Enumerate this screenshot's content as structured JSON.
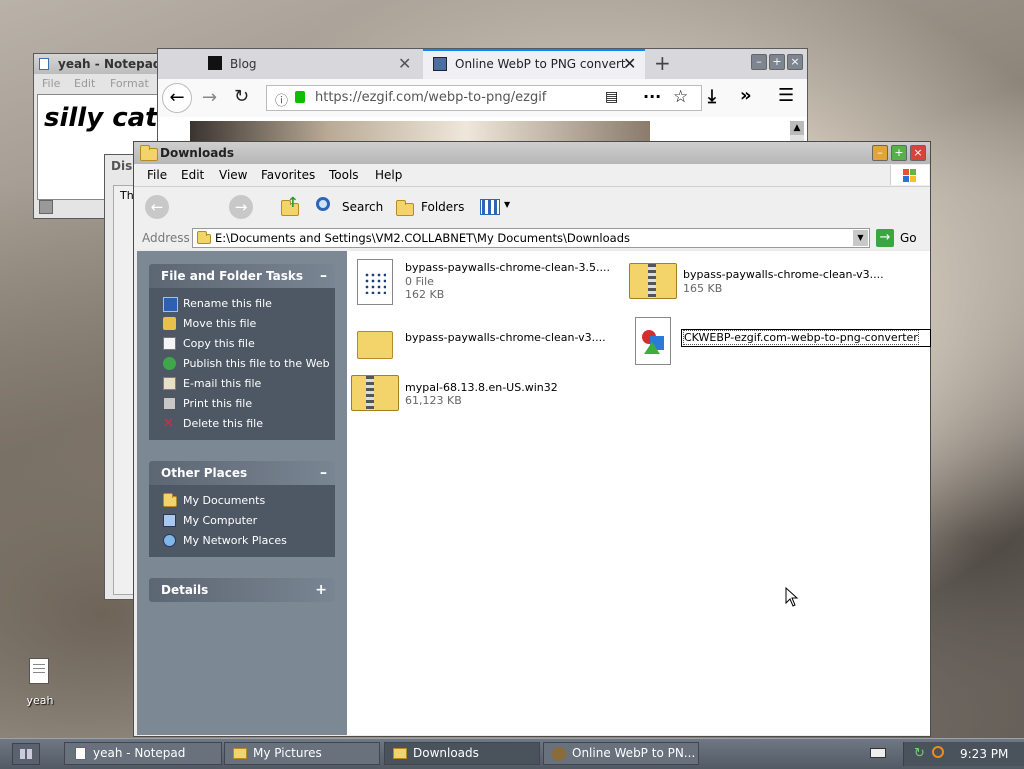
{
  "desktop": {
    "icons": [
      {
        "label": "yeah"
      }
    ]
  },
  "notepad": {
    "title": "yeah - Notepad",
    "menu": [
      "File",
      "Edit",
      "Format"
    ],
    "content": "silly cat"
  },
  "browser": {
    "tabs": [
      {
        "label": "Blog"
      },
      {
        "label": "Online WebP to PNG convert"
      }
    ],
    "url": "https://ezgif.com/webp-to-png/ezgif"
  },
  "background_window": {
    "title": "Dis",
    "tab": "Th"
  },
  "explorer": {
    "title": "Downloads",
    "menu": [
      "File",
      "Edit",
      "View",
      "Favorites",
      "Tools",
      "Help"
    ],
    "toolbar": {
      "search": "Search",
      "folders": "Folders"
    },
    "address": {
      "label": "Address",
      "path": "E:\\Documents and Settings\\VM2.COLLABNET\\My Documents\\Downloads",
      "go": "Go"
    },
    "tasks_panel": {
      "title": "File and Folder Tasks",
      "toggle": "–",
      "items": [
        "Rename this file",
        "Move this file",
        "Copy this file",
        "Publish this file to the Web",
        "E-mail this file",
        "Print this file",
        "Delete this file"
      ]
    },
    "places_panel": {
      "title": "Other Places",
      "toggle": "–",
      "items": [
        "My Documents",
        "My Computer",
        "My Network Places"
      ]
    },
    "details_panel": {
      "title": "Details",
      "toggle": "+"
    },
    "files": [
      {
        "name": "bypass-paywalls-chrome-clean-3.5....",
        "line2": "0 File",
        "line3": "162 KB"
      },
      {
        "name": "bypass-paywalls-chrome-clean-v3....",
        "line2": "165 KB"
      },
      {
        "name": "bypass-paywalls-chrome-clean-v3...."
      },
      {
        "name": "CKWEBP-ezgif.com-webp-to-png-converter"
      },
      {
        "name": "mypal-68.13.8.en-US.win32",
        "line2": "61,123 KB"
      }
    ]
  },
  "taskbar": {
    "items": [
      {
        "label": "yeah - Notepad"
      },
      {
        "label": "My Pictures"
      },
      {
        "label": "Downloads"
      },
      {
        "label": "Online WebP to PN..."
      }
    ],
    "clock": "9:23 PM"
  }
}
